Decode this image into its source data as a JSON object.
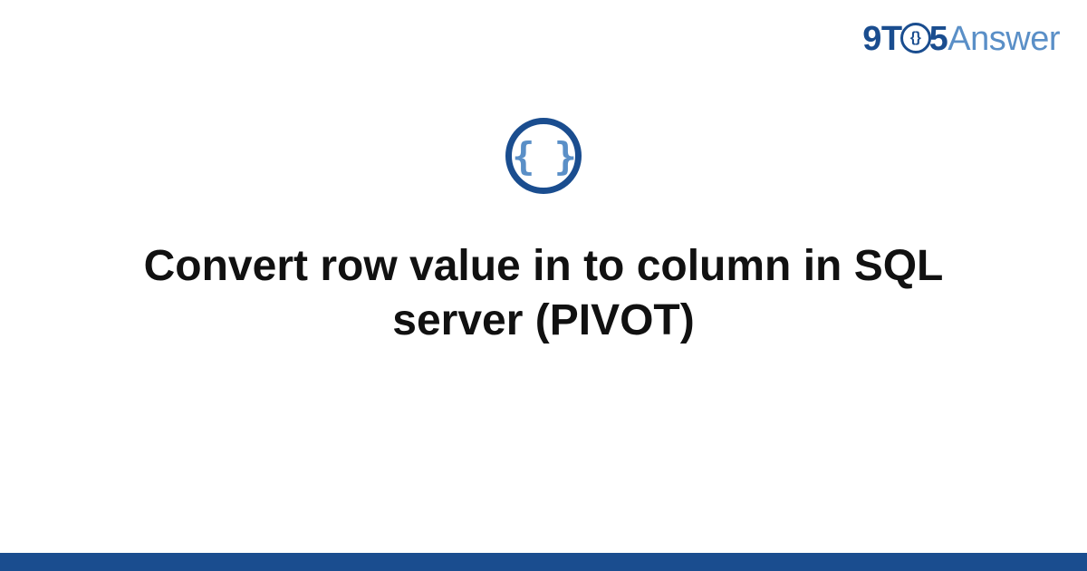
{
  "logo": {
    "part1": "9T",
    "circle_text": "{}",
    "part2": "5",
    "part3": "Answer"
  },
  "center_icon": {
    "braces": "{ }"
  },
  "title": "Convert row value in to column in SQL server (PIVOT)",
  "colors": {
    "primary": "#1a4d8f",
    "secondary": "#5a8fc7"
  }
}
